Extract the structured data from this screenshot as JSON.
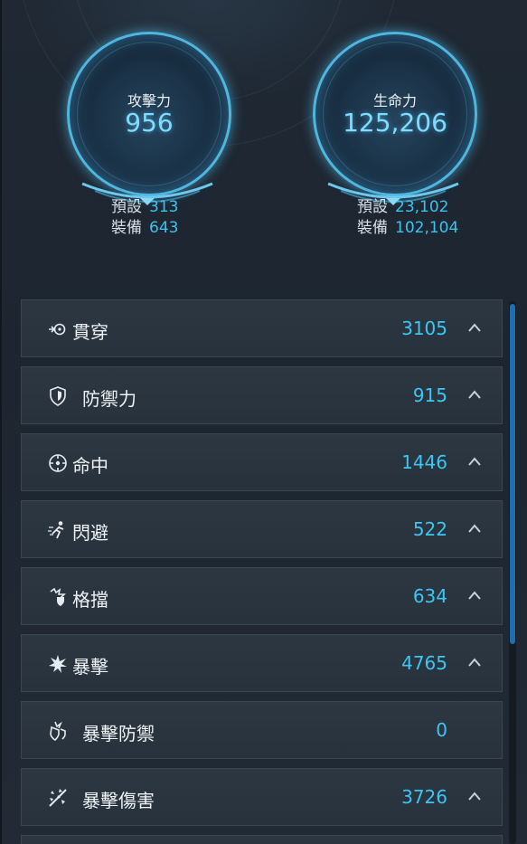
{
  "stats": {
    "attack": {
      "label": "攻擊力",
      "value": "956",
      "preset_label": "預設",
      "preset_value": "313",
      "equip_label": "裝備",
      "equip_value": "643"
    },
    "hp": {
      "label": "生命力",
      "value": "125,206",
      "preset_label": "預設",
      "preset_value": "23,102",
      "equip_label": "裝備",
      "equip_value": "102,104"
    }
  },
  "rows": [
    {
      "label": "貫穿",
      "value": "3105",
      "icon": "penetration-icon",
      "expandable": true
    },
    {
      "label": "防禦力",
      "value": "915",
      "icon": "shield-icon",
      "expandable": true
    },
    {
      "label": "命中",
      "value": "1446",
      "icon": "crosshair-icon",
      "expandable": true
    },
    {
      "label": "閃避",
      "value": "522",
      "icon": "dodge-icon",
      "expandable": true
    },
    {
      "label": "格擋",
      "value": "634",
      "icon": "block-icon",
      "expandable": true
    },
    {
      "label": "暴擊",
      "value": "4765",
      "icon": "critical-icon",
      "expandable": true
    },
    {
      "label": "暴擊防禦",
      "value": "0",
      "icon": "critical-defense-icon",
      "expandable": false
    },
    {
      "label": "暴擊傷害",
      "value": "3726",
      "icon": "critical-damage-icon",
      "expandable": true
    }
  ],
  "colors": {
    "accent": "#3cc6f4",
    "orb_ring": "#4fb6e0",
    "row_bg": "#2b353f",
    "scroll_thumb": "#1f6fb0"
  }
}
